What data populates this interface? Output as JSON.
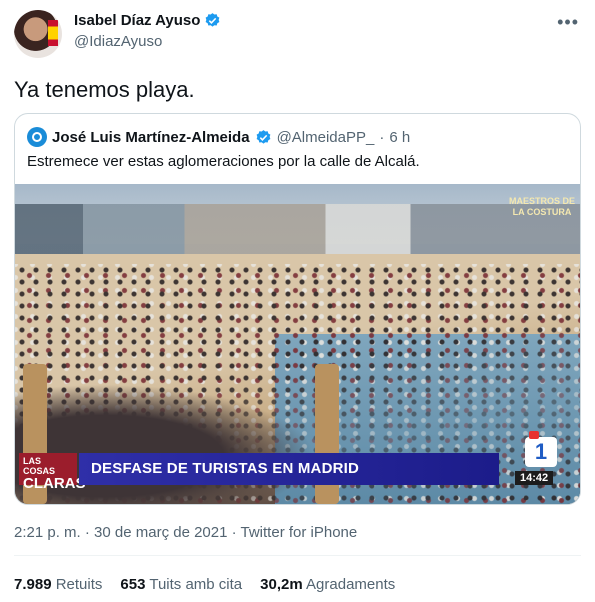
{
  "author": {
    "name": "Isabel Díaz Ayuso",
    "handle": "@IdiazAyuso",
    "more_icon": "more-horizontal-icon",
    "verified_color": "#1d9bf0"
  },
  "tweet": {
    "text": "Ya tenemos playa."
  },
  "quoted": {
    "name": "José Luis Martínez-Almeida",
    "handle": "@AlmeidaPP_",
    "separator": "·",
    "time": "6 h",
    "text": "Estremece ver estas aglomeraciones por la calle de Alcalá."
  },
  "video_overlay": {
    "show_tag_line1": "LAS COSAS",
    "show_tag_line2": "CLARAS",
    "headline": "DESFASE DE TURISTAS EN MADRID",
    "channel_logo": "1",
    "clock": "14:42",
    "corner_text": "MAESTROS DE LA COSTURA"
  },
  "meta": {
    "timestamp": "2:21 p. m. · 30 de març de 2021 · Twitter for iPhone"
  },
  "stats": [
    {
      "count": "7.989",
      "label": "Retuits"
    },
    {
      "count": "653",
      "label": "Tuits amb cita"
    },
    {
      "count": "30,2m",
      "label": "Agradaments"
    }
  ]
}
